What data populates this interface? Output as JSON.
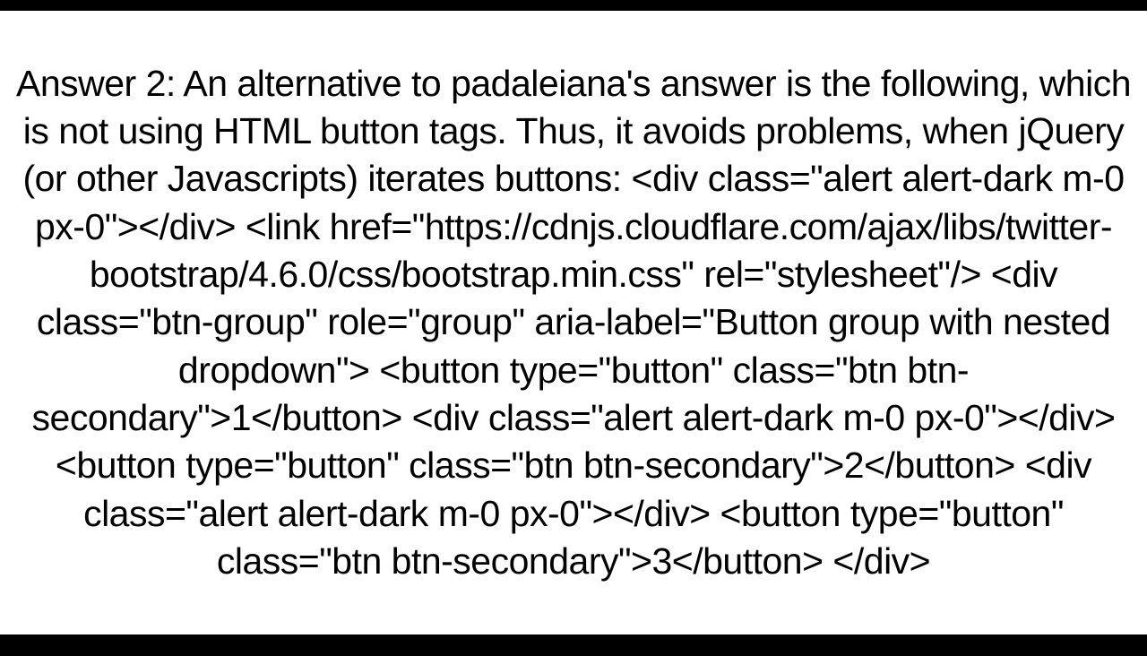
{
  "answer": {
    "text": "Answer 2: An alternative to padaleiana's answer is the following, which is not using HTML button tags. Thus, it avoids problems, when jQuery (or other Javascripts) iterates buttons: <div class=\"alert alert-dark m-0 px-0\"></div> <link href=\"https://cdnjs.cloudflare.com/ajax/libs/twitter-bootstrap/4.6.0/css/bootstrap.min.css\" rel=\"stylesheet\"/> <div class=\"btn-group\" role=\"group\" aria-label=\"Button group with nested dropdown\">   <button type=\"button\" class=\"btn btn-secondary\">1</button>   <div class=\"alert alert-dark m-0 px-0\"></div>   <button type=\"button\" class=\"btn btn-secondary\">2</button>   <div class=\"alert alert-dark m-0 px-0\"></div>   <button type=\"button\" class=\"btn btn-secondary\">3</button> </div>"
  }
}
